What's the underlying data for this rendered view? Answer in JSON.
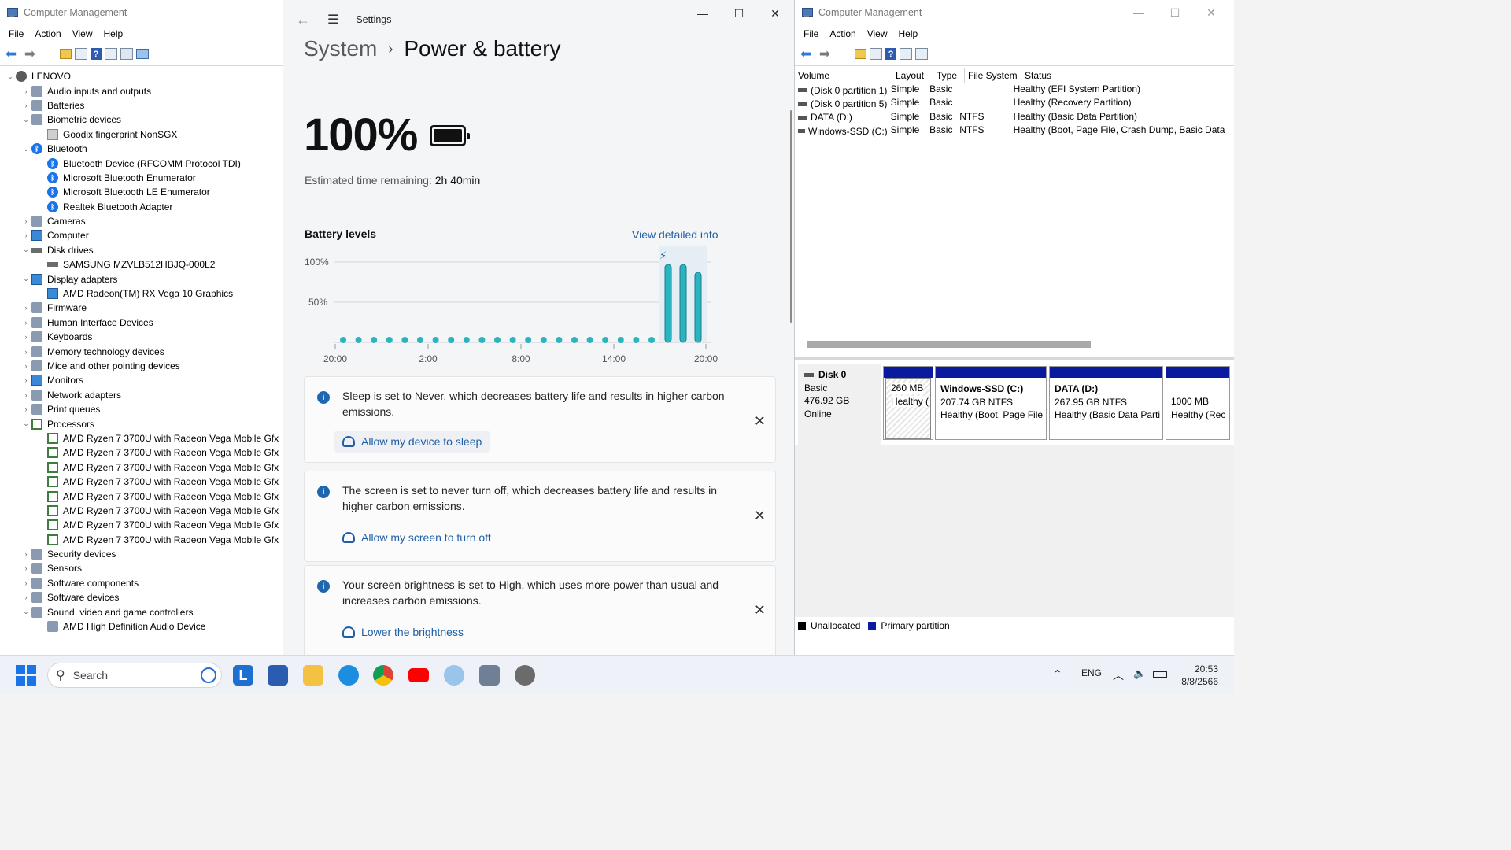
{
  "device_manager": {
    "title": "Computer Management",
    "menu": [
      "File",
      "Action",
      "View",
      "Help"
    ],
    "tree": [
      {
        "label": "LENOVO",
        "level": 0,
        "toggle": "⌄",
        "icon": "computer-icon"
      },
      {
        "label": "Audio inputs and outputs",
        "level": 1,
        "toggle": "›",
        "icon": "speaker-icon"
      },
      {
        "label": "Batteries",
        "level": 1,
        "toggle": "›",
        "icon": "battery-icon"
      },
      {
        "label": "Biometric devices",
        "level": 1,
        "toggle": "⌄",
        "icon": "biometric-icon"
      },
      {
        "label": "Goodix fingerprint NonSGX",
        "level": 2,
        "toggle": "",
        "icon": "fingerprint-icon"
      },
      {
        "label": "Bluetooth",
        "level": 1,
        "toggle": "⌄",
        "icon": "bluetooth-icon"
      },
      {
        "label": "Bluetooth Device (RFCOMM Protocol TDI)",
        "level": 2,
        "toggle": "",
        "icon": "bluetooth-icon"
      },
      {
        "label": "Microsoft Bluetooth Enumerator",
        "level": 2,
        "toggle": "",
        "icon": "bluetooth-icon"
      },
      {
        "label": "Microsoft Bluetooth LE Enumerator",
        "level": 2,
        "toggle": "",
        "icon": "bluetooth-icon"
      },
      {
        "label": "Realtek Bluetooth Adapter",
        "level": 2,
        "toggle": "",
        "icon": "bluetooth-icon"
      },
      {
        "label": "Cameras",
        "level": 1,
        "toggle": "›",
        "icon": "camera-icon"
      },
      {
        "label": "Computer",
        "level": 1,
        "toggle": "›",
        "icon": "monitor-icon"
      },
      {
        "label": "Disk drives",
        "level": 1,
        "toggle": "⌄",
        "icon": "disk-icon"
      },
      {
        "label": "SAMSUNG MZVLB512HBJQ-000L2",
        "level": 2,
        "toggle": "",
        "icon": "disk-icon"
      },
      {
        "label": "Display adapters",
        "level": 1,
        "toggle": "⌄",
        "icon": "monitor-icon"
      },
      {
        "label": "AMD Radeon(TM) RX Vega 10 Graphics",
        "level": 2,
        "toggle": "",
        "icon": "monitor-icon"
      },
      {
        "label": "Firmware",
        "level": 1,
        "toggle": "›",
        "icon": "firmware-icon"
      },
      {
        "label": "Human Interface Devices",
        "level": 1,
        "toggle": "›",
        "icon": "hid-icon"
      },
      {
        "label": "Keyboards",
        "level": 1,
        "toggle": "›",
        "icon": "keyboard-icon"
      },
      {
        "label": "Memory technology devices",
        "level": 1,
        "toggle": "›",
        "icon": "memory-icon"
      },
      {
        "label": "Mice and other pointing devices",
        "level": 1,
        "toggle": "›",
        "icon": "mouse-icon"
      },
      {
        "label": "Monitors",
        "level": 1,
        "toggle": "›",
        "icon": "monitor-icon"
      },
      {
        "label": "Network adapters",
        "level": 1,
        "toggle": "›",
        "icon": "network-icon"
      },
      {
        "label": "Print queues",
        "level": 1,
        "toggle": "›",
        "icon": "printer-icon"
      },
      {
        "label": "Processors",
        "level": 1,
        "toggle": "⌄",
        "icon": "cpu-icon"
      },
      {
        "label": "AMD Ryzen 7 3700U with Radeon Vega Mobile Gfx",
        "level": 2,
        "toggle": "",
        "icon": "cpu-icon"
      },
      {
        "label": "AMD Ryzen 7 3700U with Radeon Vega Mobile Gfx",
        "level": 2,
        "toggle": "",
        "icon": "cpu-icon"
      },
      {
        "label": "AMD Ryzen 7 3700U with Radeon Vega Mobile Gfx",
        "level": 2,
        "toggle": "",
        "icon": "cpu-icon"
      },
      {
        "label": "AMD Ryzen 7 3700U with Radeon Vega Mobile Gfx",
        "level": 2,
        "toggle": "",
        "icon": "cpu-icon"
      },
      {
        "label": "AMD Ryzen 7 3700U with Radeon Vega Mobile Gfx",
        "level": 2,
        "toggle": "",
        "icon": "cpu-icon"
      },
      {
        "label": "AMD Ryzen 7 3700U with Radeon Vega Mobile Gfx",
        "level": 2,
        "toggle": "",
        "icon": "cpu-icon"
      },
      {
        "label": "AMD Ryzen 7 3700U with Radeon Vega Mobile Gfx",
        "level": 2,
        "toggle": "",
        "icon": "cpu-icon"
      },
      {
        "label": "AMD Ryzen 7 3700U with Radeon Vega Mobile Gfx",
        "level": 2,
        "toggle": "",
        "icon": "cpu-icon"
      },
      {
        "label": "Security devices",
        "level": 1,
        "toggle": "›",
        "icon": "security-icon"
      },
      {
        "label": "Sensors",
        "level": 1,
        "toggle": "›",
        "icon": "sensor-icon"
      },
      {
        "label": "Software components",
        "level": 1,
        "toggle": "›",
        "icon": "component-icon"
      },
      {
        "label": "Software devices",
        "level": 1,
        "toggle": "›",
        "icon": "component-icon"
      },
      {
        "label": "Sound, video and game controllers",
        "level": 1,
        "toggle": "⌄",
        "icon": "speaker-icon"
      },
      {
        "label": "AMD High Definition Audio Device",
        "level": 2,
        "toggle": "",
        "icon": "speaker-icon"
      }
    ]
  },
  "settings": {
    "window_title": "Settings",
    "breadcrumb_parent": "System",
    "breadcrumb_current": "Power & battery",
    "battery_percent": "100%",
    "estimated_label": "Estimated time remaining:",
    "estimated_value": "2h 40min",
    "battery_levels_title": "Battery levels",
    "view_detailed_link": "View detailed info",
    "cards": [
      {
        "message": "Sleep is set to Never, which decreases battery life and results in higher carbon emissions.",
        "action": "Allow my device to sleep"
      },
      {
        "message": "The screen is set to never turn off, which decreases battery life and results in higher carbon emissions.",
        "action": "Allow my screen to turn off"
      },
      {
        "message": "Your screen brightness is set to High, which uses more power than usual and increases carbon emissions.",
        "action": "Lower the brightness"
      }
    ]
  },
  "chart_data": {
    "type": "bar",
    "title": "Battery levels",
    "y_ticks": [
      "100%",
      "50%"
    ],
    "x_ticks": [
      "20:00",
      "2:00",
      "8:00",
      "14:00",
      "20:00"
    ],
    "ylim": [
      0,
      100
    ],
    "dot_slots": 21,
    "bars": [
      100,
      100,
      90
    ],
    "charging_marker_on_bar": 1,
    "accent_color": "#2bb3c0"
  },
  "disk_management": {
    "title": "Computer Management",
    "menu": [
      "File",
      "Action",
      "View",
      "Help"
    ],
    "columns": [
      "Volume",
      "Layout",
      "Type",
      "File System",
      "Status"
    ],
    "volumes": [
      [
        "(Disk 0 partition 1)",
        "Simple",
        "Basic",
        "",
        "Healthy (EFI System Partition)"
      ],
      [
        "(Disk 0 partition 5)",
        "Simple",
        "Basic",
        "",
        "Healthy (Recovery Partition)"
      ],
      [
        "DATA (D:)",
        "Simple",
        "Basic",
        "NTFS",
        "Healthy (Basic Data Partition)"
      ],
      [
        "Windows-SSD (C:)",
        "Simple",
        "Basic",
        "NTFS",
        "Healthy (Boot, Page File, Crash Dump, Basic Data"
      ]
    ],
    "disk": {
      "name": "Disk 0",
      "type": "Basic",
      "size": "476.92 GB",
      "state": "Online"
    },
    "partitions": [
      {
        "name": "",
        "size": "260 MB",
        "status": "Healthy ("
      },
      {
        "name": "Windows-SSD  (C:)",
        "size": "207.74 GB NTFS",
        "status": "Healthy (Boot, Page File"
      },
      {
        "name": "DATA  (D:)",
        "size": "267.95 GB NTFS",
        "status": "Healthy (Basic Data Parti"
      },
      {
        "name": "",
        "size": "1000 MB",
        "status": "Healthy (Rec"
      }
    ],
    "legend": [
      {
        "label": "Unallocated",
        "color": "#000000"
      },
      {
        "label": "Primary partition",
        "color": "#0a1a9e"
      }
    ]
  },
  "taskbar": {
    "search_placeholder": "Search",
    "language": "ENG",
    "time": "20:53",
    "date": "8/8/2566"
  }
}
